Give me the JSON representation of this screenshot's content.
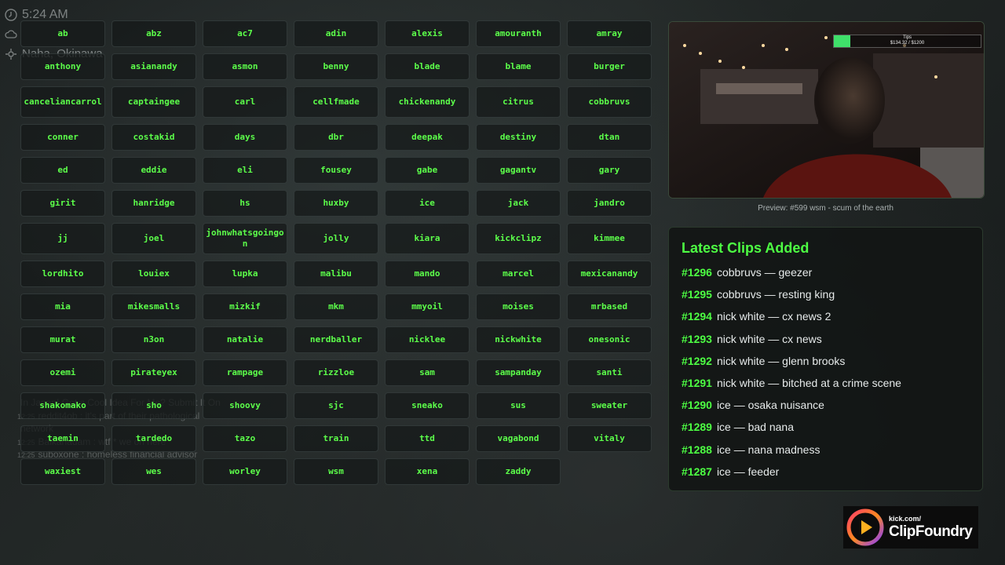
{
  "overlay": {
    "time": "5:24 AM",
    "location": "Naha, Okinawa",
    "icons": [
      "clock-icon",
      "cloud-icon",
      "location-icon"
    ]
  },
  "chat": [
    {
      "ts": "",
      "text": "In Japan! Got a Cool Idea For Me? Submit It On"
    },
    {
      "ts": "12:25",
      "text": "reddit4ob : it's part of their pathological"
    },
    {
      "ts": "",
      "text": "network"
    },
    {
      "ts": "12:25",
      "text": "Balkanadam : wtf * we on here"
    },
    {
      "ts": "12:25",
      "text": "suboxone : homeless financial advisor"
    }
  ],
  "buttons": [
    "ab",
    "abz",
    "ac7",
    "adin",
    "alexis",
    "amouranth",
    "amray",
    "anthony",
    "asianandy",
    "asmon",
    "benny",
    "blade",
    "blame",
    "burger",
    "canceliancarrol",
    "captaingee",
    "carl",
    "cellfmade",
    "chickenandy",
    "citrus",
    "cobbruvs",
    "conner",
    "costakid",
    "days",
    "dbr",
    "deepak",
    "destiny",
    "dtan",
    "ed",
    "eddie",
    "eli",
    "fousey",
    "gabe",
    "gagantv",
    "gary",
    "girit",
    "hanridge",
    "hs",
    "huxby",
    "ice",
    "jack",
    "jandro",
    "jj",
    "joel",
    "johnwhatsgoingon",
    "jolly",
    "kiara",
    "kickclipz",
    "kimmee",
    "lordhito",
    "louiex",
    "lupka",
    "malibu",
    "mando",
    "marcel",
    "mexicanandy",
    "mia",
    "mikesmalls",
    "mizkif",
    "mkm",
    "mmyoil",
    "moises",
    "mrbased",
    "murat",
    "n3on",
    "natalie",
    "nerdballer",
    "nicklee",
    "nickwhite",
    "onesonic",
    "ozemi",
    "pirateyex",
    "rampage",
    "rizzloe",
    "sam",
    "sampanday",
    "santi",
    "shakomako",
    "sho",
    "shoovy",
    "sjc",
    "sneako",
    "sus",
    "sweater",
    "taemin",
    "tardedo",
    "tazo",
    "train",
    "ttd",
    "vagabond",
    "vitaly",
    "waxiest",
    "wes",
    "worley",
    "wsm",
    "xena",
    "zaddy"
  ],
  "preview": {
    "tips_label": "Tips",
    "tips_amount": "$134.32 / $1200",
    "tips_progress": 0.112,
    "caption": "Preview: #599 wsm - scum of the earth"
  },
  "clips": {
    "title": "Latest Clips Added",
    "items": [
      {
        "num": "#1296",
        "text": "cobbruvs — geezer"
      },
      {
        "num": "#1295",
        "text": "cobbruvs — resting king"
      },
      {
        "num": "#1294",
        "text": "nick white — cx news 2"
      },
      {
        "num": "#1293",
        "text": "nick white — cx news"
      },
      {
        "num": "#1292",
        "text": "nick white — glenn brooks"
      },
      {
        "num": "#1291",
        "text": "nick white — bitched at a crime scene"
      },
      {
        "num": "#1290",
        "text": "ice — osaka nuisance"
      },
      {
        "num": "#1289",
        "text": "ice — bad nana"
      },
      {
        "num": "#1288",
        "text": "ice — nana madness"
      },
      {
        "num": "#1287",
        "text": "ice — feeder"
      }
    ]
  },
  "logo": {
    "small": "kick.com/",
    "big": "ClipFoundry"
  },
  "colors": {
    "accent": "#4dff43",
    "button_text": "#5cff4a",
    "tips_bar": "#3fe06a"
  }
}
